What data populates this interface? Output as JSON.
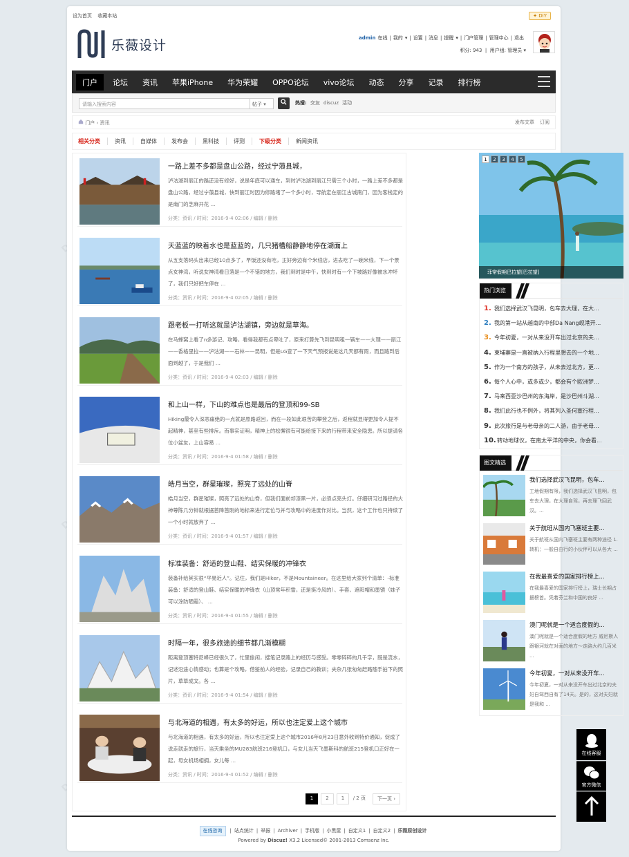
{
  "topbar": {
    "set_home": "设为首页",
    "bookmark": "收藏本站",
    "diy": "✦ DIY"
  },
  "brand": {
    "logo_text": "乐薇设计",
    "accent": "#2e3c55"
  },
  "user": {
    "line1": [
      "admin",
      "在线",
      "|",
      "我的",
      "▾",
      "|",
      "设置",
      "|",
      "消息",
      "|",
      "提醒",
      "▾",
      "|",
      "门户管理",
      "|",
      "管理中心",
      "|",
      "退出"
    ],
    "credits": "积分: 943",
    "group": "用户组: 管理员"
  },
  "nav": {
    "items": [
      "门户",
      "论坛",
      "资讯",
      "苹果iPhone",
      "华为荣耀",
      "OPPO论坛",
      "vivo论坛",
      "动态",
      "分享",
      "记录",
      "排行榜"
    ]
  },
  "search": {
    "placeholder": "请输入搜索内容",
    "scope": "帖子 ▾",
    "hot_label": "热搜:",
    "hot": [
      "交友",
      "discuz",
      "活动"
    ]
  },
  "breadcrumb": {
    "home_icon": "home-icon",
    "items": [
      "门户",
      "›",
      "资讯"
    ],
    "right": [
      "发布文章",
      "订阅"
    ]
  },
  "categories": {
    "related_label": "相关分类",
    "related": [
      "资讯",
      "自媒体",
      "发布会",
      "黑科技",
      "评测"
    ],
    "sub_label": "下级分类",
    "sub": [
      "新闻资讯"
    ]
  },
  "articles": [
    {
      "title": "一路上差不多都是盘山公路，经过宁蒗县城，",
      "summary": "泸沽湖到丽江的路还没有修好，说是年底可以通车，到时泸沽湖到丽江只需三个小时，一路上差不多都是盘山公路，经过宁蒗县城，快到丽江时因为修路堵了一个多小时，导航定在丽江古城南门，因为客栈定的是南门的芝麻开花 ...",
      "meta": "分类：资讯   /   时间：2016-9-4 02:06   /   编辑   /   删除",
      "scene": "town"
    },
    {
      "title": "天蓝蓝的映着水也是蓝蓝的，几只猪槽船静静地停在湖面上",
      "summary": "从五支落码头出来已经10点多了，早饭还没有吃，正好旁边有个米线店，进去吃了一碗米线，下一个景点女神湾，听说女神湾看日落是一个不错的地方，我们到时是中午，快到时有一个下坡路好像被水冲坏了，我们只好把车停在 ...",
      "meta": "分类：资讯   /   时间：2016-9-4 02:05   /   编辑   /   删除",
      "scene": "lake"
    },
    {
      "title": "跟老板一打听这就是泸沽湖镇，旁边就是草海。",
      "summary": "在马蜂窝上看了n多游记、攻略，看得我都有点晕吐了，原来打算先飞到昆明租一辆车——大理——丽江——香格里拉——泸沽湖——石林——昆明，但是LG查了一下天气预报说是这几天都有雨，而且路到后面到越了，于是我们 ...",
      "meta": "分类：资讯   /   时间：2016-9-4 02:03   /   编辑   /   删除",
      "scene": "boardwalk"
    },
    {
      "title": "和上山一样，下山的难点也是最后的登顶和99-SB",
      "summary": "Hiking最令人深恶痛绝的一点就是原路返回，而在一段如此艰苦的攀登之后，返程就显得更加令人提不起精神，甚至有些排斥。而事实证明，精神上的松懈很有可能给接下来的行程带来安全隐患。所以提请各位小盆友，上山容易 ...",
      "meta": "分类：资讯   /   时间：2016-9-4 01:58   /   编辑   /   删除",
      "scene": "snow"
    },
    {
      "title": "皓月当空，群星璀璨，照亮了远处的山脊",
      "summary": "皓月当空，群星璀璨，照亮了远处的山脊，但我们面前却漆黑一片，必须点亮头灯。仔细研习过路径的大神尊陈几分钟就根据首降首刚的地标来进行定位与并与攻略中的进度作对比。当然，这个工作也只持续了一个小时就放弃了 ...",
      "meta": "分类：资讯   /   时间：2016-9-4 01:57   /   编辑   /   删除",
      "scene": "mountain"
    },
    {
      "title": "标准装备：舒适的登山鞋、结实保暖的冲锋衣",
      "summary": "装备补给其实很“平易近人”。记住，我们是Hiker，不是Mountaineer。在这里给大家列个清单：-标准装备：舒适的登山鞋、结实保暖的冲锋衣（山顶常年积雪，还是挺冷风的）、手套、遮阳帽和墨镜（妹子可以涂防晒霜）、 ...",
      "meta": "分类：资讯   /   时间：2016-9-4 01:55   /   编辑   /   删除",
      "scene": "temple"
    },
    {
      "title": "时隔一年，很多旅途的细节都几渐模糊",
      "summary": "距离登顶塞特尼峰已经很久了，忙里偷闲，搜笔记录路上的经历与感受。零零碎碎的几千字，既是流水，记述沿途心情感动；也算是个攻略，借鉴前人的经验，记录自己的教训；夹杂几张匆匆赶路随手拍下的照片，草草成文。各 ...",
      "meta": "分类：资讯   /   时间：2016-9-4 01:54   /   编辑   /   删除",
      "scene": "white"
    },
    {
      "title": "与北海道的相遇，有太多的好运，所以也注定爱上这个城市",
      "summary": "与北海道的相遇，有太多的好运，所以也注定爱上这个城市2016年8月23日意外收到特价通知，促成了说走就走的旅行，当天乘坐的MU283航班216登机口，与女儿当天飞墨斯科的航班215登机口正好在一起，母女机场相拥，女儿每 ...",
      "meta": "分类：资讯   /   时间：2016-9-4 01:52   /   编辑   /   删除",
      "scene": "dinner"
    }
  ],
  "pager": {
    "current": "1",
    "next_page": "2",
    "input": "1",
    "total": "/ 2 页",
    "next": "下一页 ›"
  },
  "slider": {
    "nums": [
      "1",
      "2",
      "3",
      "4",
      "5"
    ],
    "caption": "菲常假期巴拉望[巴拉望]"
  },
  "hot_box": {
    "title": "热门浏览",
    "items": [
      {
        "rank": "1.",
        "text": "我们选择武汉飞昆明，包车去大理，在大..."
      },
      {
        "rank": "2.",
        "text": "我的第一站从越南的中部Da Nang岘港开..."
      },
      {
        "rank": "3.",
        "text": "今年初夏，一对从来没开车出过北京的夫..."
      },
      {
        "rank": "4.",
        "text": "柬埔寨是一直被纳入行程里想去的一个地..."
      },
      {
        "rank": "5.",
        "text": "作为一个南方的孩子，从未去过北方，更..."
      },
      {
        "rank": "6.",
        "text": "每个人心中，或多或少，都会有个欧洲梦..."
      },
      {
        "rank": "7.",
        "text": "马来西亚沙巴州的东海岸，是沙巴州斗湖..."
      },
      {
        "rank": "8.",
        "text": "我们此行也不例外，将其列入圣何塞行程..."
      },
      {
        "rank": "9.",
        "text": "此次旅行是与老母亲的二人游，由于老母..."
      },
      {
        "rank": "10.",
        "text": "转动地球仪，在南太平洋的中央，你会看..."
      }
    ]
  },
  "pic_box": {
    "title": "图文精选",
    "items": [
      {
        "title": "我们选择武汉飞昆明，包车...",
        "summary": "工地假期有限，我们选择武汉飞昆明，包车去大理，在大理自驾，再去理飞回武汉。...",
        "scene": "palm"
      },
      {
        "title": "关于航班从国内飞塞班主要...",
        "summary": "关于航班从国内飞塞班主要有两种途径 1. 转机：一般自由行的小伙伴可以从各大 ...",
        "scene": "street"
      },
      {
        "title": "在我最喜爱的国家排行榜上...",
        "summary": "在我最喜爱的国家排行榜上，瑞士长期占据榜首。凭着芬兰和中国的良好 ...",
        "scene": "beach"
      },
      {
        "title": "澳门呢就是一个适合度假的...",
        "summary": "澳门呢就是一个适合度假的地方 威尼斯人跟银河就在对面的地方～走路大约几百米 ...",
        "scene": "girl"
      },
      {
        "title": "今年初夏，一对从来没开车...",
        "summary": "今年初夏，一对从来没开车出过北京的夫妇自驾西自有了14天。是的，这对夫妇就是我和 ...",
        "scene": "wind"
      }
    ]
  },
  "footer": {
    "qq": "在线咨询",
    "links": [
      "|",
      "站点统计",
      "|",
      "举报",
      "|",
      "Archiver",
      "|",
      "手机版",
      "|",
      "小黑屋",
      "|",
      "自定义1",
      "|",
      "自定义2",
      "|",
      "乐薇原创设计"
    ],
    "powered": "Powered by",
    "brand": "Discuz!",
    "version": "X3.2 Licensed© 2001-2013 Comsenz Inc."
  },
  "float": {
    "service": "在线客服",
    "wechat": "官方微信"
  }
}
